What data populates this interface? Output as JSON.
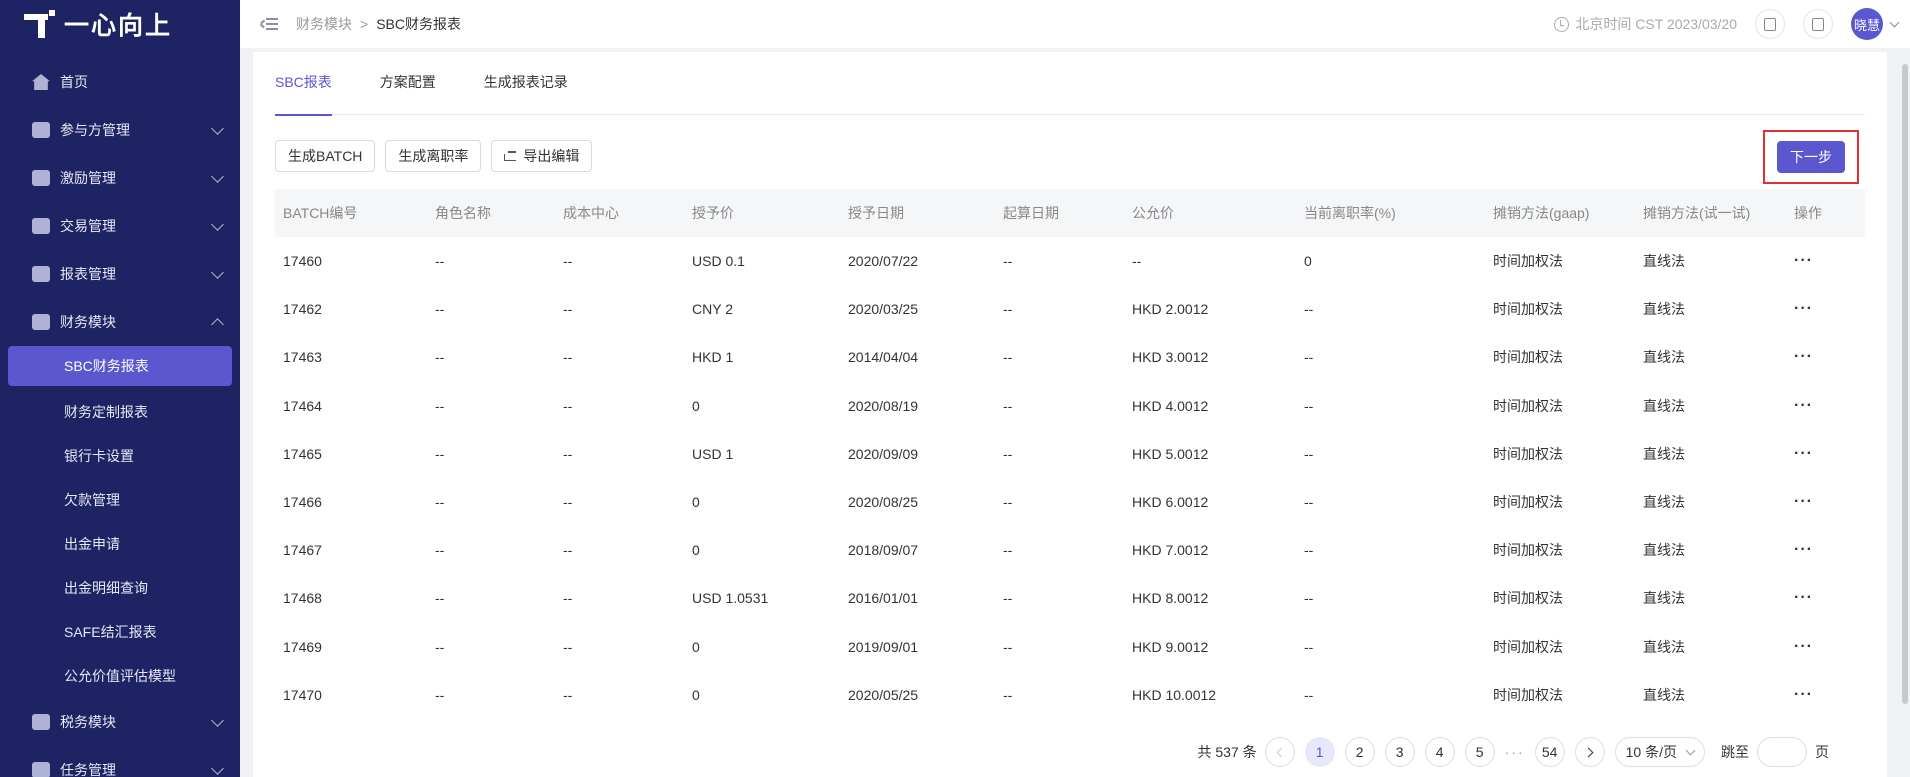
{
  "app": {
    "logo_text": "一心向上"
  },
  "sidebar": {
    "items": [
      {
        "label": "首页",
        "icon": "home-icon"
      },
      {
        "label": "参与方管理",
        "icon": "participants-icon"
      },
      {
        "label": "激励管理",
        "icon": "incentive-icon"
      },
      {
        "label": "交易管理",
        "icon": "transaction-icon"
      },
      {
        "label": "报表管理",
        "icon": "report-icon"
      },
      {
        "label": "财务模块",
        "icon": "finance-icon"
      }
    ],
    "sub_items": [
      "SBC财务报表",
      "财务定制报表",
      "银行卡设置",
      "欠款管理",
      "出金申请",
      "出金明细查询",
      "SAFE结汇报表",
      "公允价值评估模型"
    ],
    "bottom_items": [
      {
        "label": "税务模块",
        "icon": "tax-icon"
      },
      {
        "label": "任务管理",
        "icon": "task-icon"
      }
    ]
  },
  "header": {
    "breadcrumb": [
      "财务模块",
      "SBC财务报表"
    ],
    "time_text": "北京时间 CST 2023/03/20",
    "avatar_text": "晓慧"
  },
  "tabs": [
    "SBC报表",
    "方案配置",
    "生成报表记录"
  ],
  "toolbar": {
    "generate_batch": "生成BATCH",
    "generate_turnover": "生成离职率",
    "export_edit": "导出编辑",
    "next": "下一步"
  },
  "table": {
    "headers": [
      "BATCH编号",
      "角色名称",
      "成本中心",
      "授予价",
      "授予日期",
      "起算日期",
      "公允价",
      "当前离职率(%)",
      "摊销方法(gaap)",
      "摊销方法(试一试)",
      "操作"
    ],
    "rows": [
      [
        "17460",
        "--",
        "--",
        "USD 0.1",
        "2020/07/22",
        "--",
        "--",
        "0",
        "时间加权法",
        "直线法",
        "···"
      ],
      [
        "17462",
        "--",
        "--",
        "CNY 2",
        "2020/03/25",
        "--",
        "HKD 2.0012",
        "--",
        "时间加权法",
        "直线法",
        "···"
      ],
      [
        "17463",
        "--",
        "--",
        "HKD 1",
        "2014/04/04",
        "--",
        "HKD 3.0012",
        "--",
        "时间加权法",
        "直线法",
        "···"
      ],
      [
        "17464",
        "--",
        "--",
        "0",
        "2020/08/19",
        "--",
        "HKD 4.0012",
        "--",
        "时间加权法",
        "直线法",
        "···"
      ],
      [
        "17465",
        "--",
        "--",
        "USD 1",
        "2020/09/09",
        "--",
        "HKD 5.0012",
        "--",
        "时间加权法",
        "直线法",
        "···"
      ],
      [
        "17466",
        "--",
        "--",
        "0",
        "2020/08/25",
        "--",
        "HKD 6.0012",
        "--",
        "时间加权法",
        "直线法",
        "···"
      ],
      [
        "17467",
        "--",
        "--",
        "0",
        "2018/09/07",
        "--",
        "HKD 7.0012",
        "--",
        "时间加权法",
        "直线法",
        "···"
      ],
      [
        "17468",
        "--",
        "--",
        "USD 1.0531",
        "2016/01/01",
        "--",
        "HKD 8.0012",
        "--",
        "时间加权法",
        "直线法",
        "···"
      ],
      [
        "17469",
        "--",
        "--",
        "0",
        "2019/09/01",
        "--",
        "HKD 9.0012",
        "--",
        "时间加权法",
        "直线法",
        "···"
      ],
      [
        "17470",
        "--",
        "--",
        "0",
        "2020/05/25",
        "--",
        "HKD 10.0012",
        "--",
        "时间加权法",
        "直线法",
        "···"
      ]
    ]
  },
  "pagination": {
    "total_text": "共 537 条",
    "pages": [
      "1",
      "2",
      "3",
      "4",
      "5"
    ],
    "ellipsis": "···",
    "last_page": "54",
    "page_size": "10 条/页",
    "jump_label": "跳至",
    "page_suffix": "页"
  },
  "colors": {
    "sidebar_bg": "#1d2363",
    "accent": "#5b57cf",
    "highlight_border": "#e0302e"
  }
}
